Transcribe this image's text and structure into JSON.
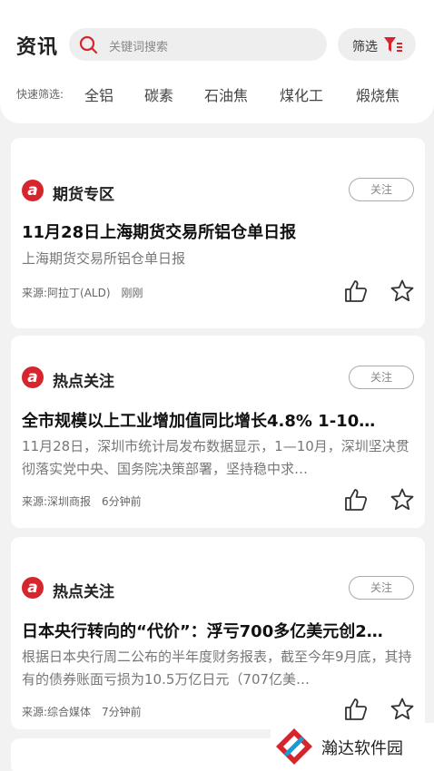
{
  "header": {
    "title": "资讯",
    "search_placeholder": "关键词搜索",
    "filter_label": "筛选"
  },
  "quick_filter": {
    "label": "快速筛选:",
    "chips": [
      "全铝",
      "碳素",
      "石油焦",
      "煤化工",
      "煅烧焦"
    ]
  },
  "colors": {
    "accent": "#d6262d",
    "background": "#f2f2f2"
  },
  "cards": [
    {
      "category": "期货专区",
      "follow_label": "关注",
      "headline": "11月28日上海期货交易所铝仓单日报",
      "summary": "上海期货交易所铝仓单日报",
      "source": "来源:阿拉丁(ALD)",
      "time": "刚刚"
    },
    {
      "category": "热点关注",
      "follow_label": "关注",
      "headline": "全市规模以上工业增加值同比增长4.8% 1-10…",
      "summary": "11月28日，深圳市统计局发布数据显示，1—10月，深圳坚决贯彻落实党中央、国务院决策部署，坚持稳中求…",
      "source": "来源:深圳商报",
      "time": "6分钟前"
    },
    {
      "category": "热点关注",
      "follow_label": "关注",
      "headline": "日本央行转向的“代价”：浮亏700多亿美元创2…",
      "summary": "根据日本央行周二公布的半年度财务报表，截至今年9月底，其持有的债券账面亏损为10.5万亿日元（707亿美…",
      "source": "来源:综合媒体",
      "time": "7分钟前"
    }
  ],
  "watermark": {
    "text": "瀚达软件园"
  }
}
